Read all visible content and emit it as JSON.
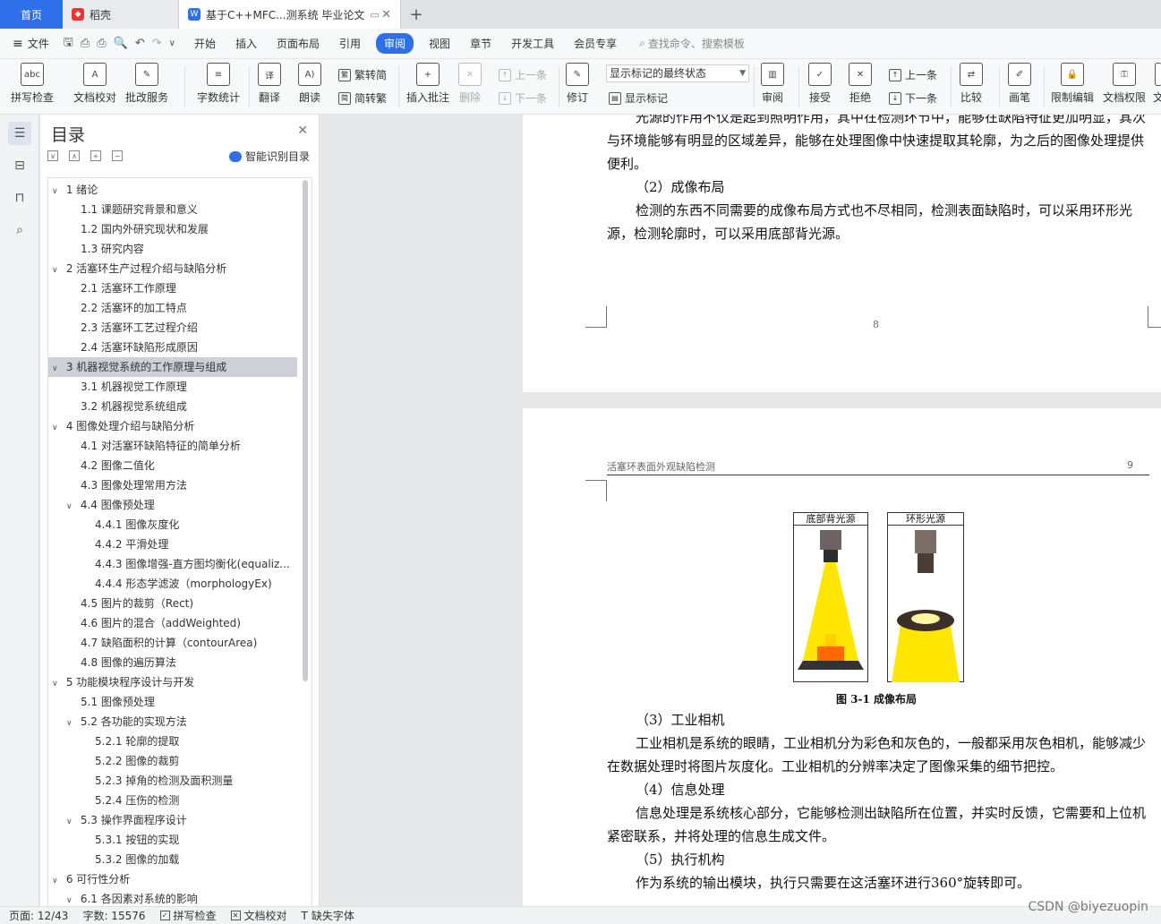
{
  "tabs": {
    "home": "首页",
    "wps": "稻壳",
    "doc": "基于C++MFC...测系统 毕业论文"
  },
  "menu": {
    "file": "文件",
    "items": [
      "开始",
      "插入",
      "页面布局",
      "引用",
      "审阅",
      "视图",
      "章节",
      "开发工具",
      "会员专享"
    ],
    "active_index": 4,
    "search": "查找命令、搜索模板"
  },
  "ribbon": {
    "spell": "拼写检查",
    "doc_check": "文档校对",
    "batch": "批改服务",
    "word_count": "字数统计",
    "translate": "翻译",
    "read": "朗读",
    "trad": "繁转简",
    "simp": "简转繁",
    "insert_comment": "插入批注",
    "delete": "删除",
    "prev": "上一条",
    "next": "下一条",
    "revise": "修订",
    "markup_state": "显示标记的最终状态",
    "show_markup": "显示标记",
    "review": "审阅",
    "accept": "接受",
    "reject": "拒绝",
    "prev2": "上一条",
    "next2": "下一条",
    "compare": "比较",
    "pen": "画笔",
    "restrict": "限制编辑",
    "rights": "文档权限",
    "more": "文"
  },
  "toc": {
    "title": "目录",
    "smart": "智能识别目录",
    "items": [
      {
        "text": "1  绪论",
        "level": 1,
        "chev": "∨"
      },
      {
        "text": "1.1  课题研究背景和意义",
        "level": 2
      },
      {
        "text": "1.2 国内外研究现状和发展",
        "level": 2
      },
      {
        "text": "1.3 研究内容",
        "level": 2
      },
      {
        "text": "2  活塞环生产过程介绍与缺陷分析",
        "level": 1,
        "chev": "∨"
      },
      {
        "text": "2.1 活塞环工作原理",
        "level": 2
      },
      {
        "text": "2.2 活塞环的加工特点",
        "level": 2
      },
      {
        "text": "2.3 活塞环工艺过程介绍",
        "level": 2
      },
      {
        "text": "2.4 活塞环缺陷形成原因",
        "level": 2
      },
      {
        "text": "3  机器视觉系统的工作原理与组成",
        "level": 1,
        "chev": "∨",
        "selected": true
      },
      {
        "text": "3.1 机器视觉工作原理",
        "level": 2
      },
      {
        "text": "3.2 机器视觉系统组成",
        "level": 2
      },
      {
        "text": "4  图像处理介绍与缺陷分析",
        "level": 1,
        "chev": "∨"
      },
      {
        "text": "4.1 对活塞环缺陷特征的简单分析",
        "level": 2
      },
      {
        "text": "4.2 图像二值化",
        "level": 2
      },
      {
        "text": "4.3 图像处理常用方法",
        "level": 2
      },
      {
        "text": "4.4 图像预处理",
        "level": 2,
        "chev": "∨"
      },
      {
        "text": "4.4.1 图像灰度化",
        "level": 3
      },
      {
        "text": "4.4.2 平滑处理",
        "level": 3
      },
      {
        "text": "4.4.3 图像增强-直方图均衡化(equaliz...",
        "level": 3
      },
      {
        "text": "4.4.4 形态学滤波（morphologyEx)",
        "level": 3
      },
      {
        "text": "4.5 图片的裁剪（Rect)",
        "level": 2
      },
      {
        "text": "4.6 图片的混合（addWeighted)",
        "level": 2
      },
      {
        "text": "4.7 缺陷面积的计算（contourArea)",
        "level": 2
      },
      {
        "text": "4.8 图像的遍历算法",
        "level": 2
      },
      {
        "text": "5  功能模块程序设计与开发",
        "level": 1,
        "chev": "∨"
      },
      {
        "text": "5.1 图像预处理",
        "level": 2
      },
      {
        "text": "5.2 各功能的实现方法",
        "level": 2,
        "chev": "∨"
      },
      {
        "text": "5.2.1 轮廓的提取",
        "level": 3
      },
      {
        "text": "5.2.2 图像的裁剪",
        "level": 3
      },
      {
        "text": "5.2.3 掉角的检测及面积测量",
        "level": 3
      },
      {
        "text": "5.2.4 压伤的检测",
        "level": 3
      },
      {
        "text": "5.3 操作界面程序设计",
        "level": 2,
        "chev": "∨"
      },
      {
        "text": "5.3.1 按钮的实现",
        "level": 3
      },
      {
        "text": "5.3.2 图像的加载",
        "level": 3
      },
      {
        "text": "6  可行性分析",
        "level": 1,
        "chev": "∨"
      },
      {
        "text": "6.1 各因素对系统的影响",
        "level": 2,
        "chev": "∨"
      }
    ]
  },
  "page1": {
    "p0": "光源的作用不仅是起到照明作用，其中在检测环节中，能够在缺陷特征更加明显，其次与环境能够有明显的区域差异，能够在处理图像中快速提取其轮廓，为之后的图像处理提供便利。",
    "h2": "（2）成像布局",
    "p2": "检测的东西不同需要的成像布局方式也不尽相同，检测表面缺陷时，可以采用环形光源，检测轮廓时，可以采用底部背光源。",
    "page_num": "8"
  },
  "page2": {
    "header": "活塞环表面外观缺陷检测",
    "page_num": "9",
    "fig_left": "底部背光源",
    "fig_right": "环形光源",
    "fig_caption": "图 3-1  成像布局",
    "h3": "（3）工业相机",
    "p3": "工业相机是系统的眼睛，工业相机分为彩色和灰色的，一般都采用灰色相机，能够减少在数据处理时将图片灰度化。工业相机的分辨率决定了图像采集的细节把控。",
    "h4": "（4）信息处理",
    "p4": "信息处理是系统核心部分，它能够检测出缺陷所在位置，并实时反馈，它需要和上位机紧密联系，并将处理的信息生成文件。",
    "h5": "（5）执行机构",
    "p5": "作为系统的输出模块，执行只需要在这活塞环进行360°旋转即可。"
  },
  "status": {
    "page": "页面: 12/43",
    "words": "字数: 15576",
    "spell": "拼写检查",
    "check": "文档校对",
    "font": "缺失字体"
  },
  "watermark": "CSDN @biyezuopin",
  "colors": {
    "accent": "#2f6fe8",
    "light": "#ffe600",
    "selected": "#cdd1d7"
  }
}
